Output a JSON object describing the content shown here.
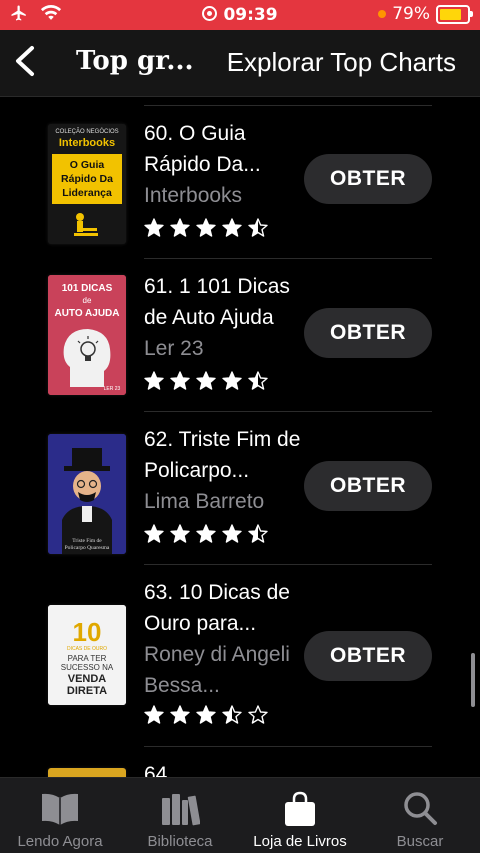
{
  "status_bar": {
    "time": "09:39",
    "battery": "79%",
    "battery_level": 0.79
  },
  "nav": {
    "back_label": "Voltar",
    "title": "Top gr...",
    "action": "Explorar Top Charts"
  },
  "books": [
    {
      "rank_title": "60. O Guia Rápido Da...",
      "author": "Interbooks",
      "rating": 4.5,
      "button": "OBTER",
      "cover": {
        "top": "COLEÇÃO NEGÓCIOS",
        "brand": "Interbooks",
        "text": "O Guia Rápido Da Liderança"
      }
    },
    {
      "rank_title": "61. 1 101 Dicas de Auto Ajuda",
      "author": "Ler 23",
      "rating": 4.5,
      "button": "OBTER",
      "cover": {
        "line1": "101 DICAS",
        "line2": "de",
        "line3": "AUTO AJUDA",
        "brand": "LER 23"
      }
    },
    {
      "rank_title": "62. Triste Fim de Policarpo...",
      "author": "Lima Barreto",
      "rating": 4.5,
      "button": "OBTER",
      "cover": {
        "text": "Triste Fim de Policarpo Quaresma"
      }
    },
    {
      "rank_title": "63. 10 Dicas de Ouro para...",
      "author": "Roney di Angeli Bessa...",
      "rating": 3.5,
      "button": "OBTER",
      "cover": {
        "num": "10",
        "sub": "DICAS DE OURO",
        "line1": "PARA TER",
        "line2": "SUCESSO NA",
        "line3": "VENDA",
        "line4": "DIRETA"
      }
    },
    {
      "rank_title": "64."
    }
  ],
  "tabs": [
    {
      "label": "Lendo Agora",
      "icon": "book-open-icon"
    },
    {
      "label": "Biblioteca",
      "icon": "library-icon"
    },
    {
      "label": "Loja de Livros",
      "icon": "shopping-bag-icon"
    },
    {
      "label": "Buscar",
      "icon": "search-icon"
    }
  ],
  "colors": {
    "status_bar": "#e4363f",
    "star": "#ffffff",
    "active_tab": "#ffffff",
    "inactive_tab": "#8e8e93"
  }
}
